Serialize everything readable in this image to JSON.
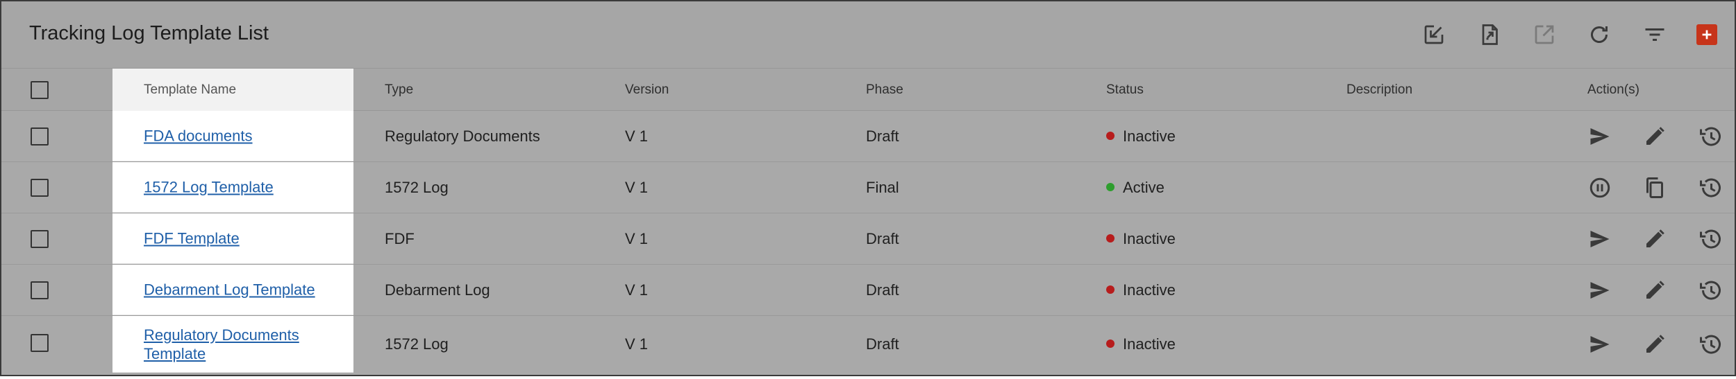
{
  "header": {
    "title": "Tracking Log Template List",
    "tools": [
      "import-icon",
      "export-file-icon",
      "open-external-icon",
      "refresh-icon",
      "filter-icon"
    ],
    "add_icon": "plus-icon",
    "accent": "#c7341a"
  },
  "table": {
    "columns": {
      "name": "Template Name",
      "type": "Type",
      "version": "Version",
      "phase": "Phase",
      "status": "Status",
      "description": "Description",
      "actions": "Action(s)"
    },
    "status_colors": {
      "Inactive": "#b71c1c",
      "Active": "#2e9e2e"
    },
    "rows": [
      {
        "name": "FDA documents",
        "type": "Regulatory Documents",
        "version": "V 1",
        "phase": "Draft",
        "status": "Inactive",
        "description": "",
        "actions": [
          "send-icon",
          "edit-icon",
          "history-icon"
        ]
      },
      {
        "name": "1572 Log Template",
        "type": "1572 Log",
        "version": "V 1",
        "phase": "Final",
        "status": "Active",
        "description": "",
        "actions": [
          "pause-icon",
          "copy-icon",
          "history-icon"
        ]
      },
      {
        "name": "FDF Template",
        "type": "FDF",
        "version": "V 1",
        "phase": "Draft",
        "status": "Inactive",
        "description": "",
        "actions": [
          "send-icon",
          "edit-icon",
          "history-icon"
        ]
      },
      {
        "name": "Debarment Log Template",
        "type": "Debarment Log",
        "version": "V 1",
        "phase": "Draft",
        "status": "Inactive",
        "description": "",
        "actions": [
          "send-icon",
          "edit-icon",
          "history-icon"
        ]
      },
      {
        "name": "Regulatory Documents Template",
        "type": "1572 Log",
        "version": "V 1",
        "phase": "Draft",
        "status": "Inactive",
        "description": "",
        "actions": [
          "send-icon",
          "edit-icon",
          "history-icon"
        ]
      }
    ]
  }
}
